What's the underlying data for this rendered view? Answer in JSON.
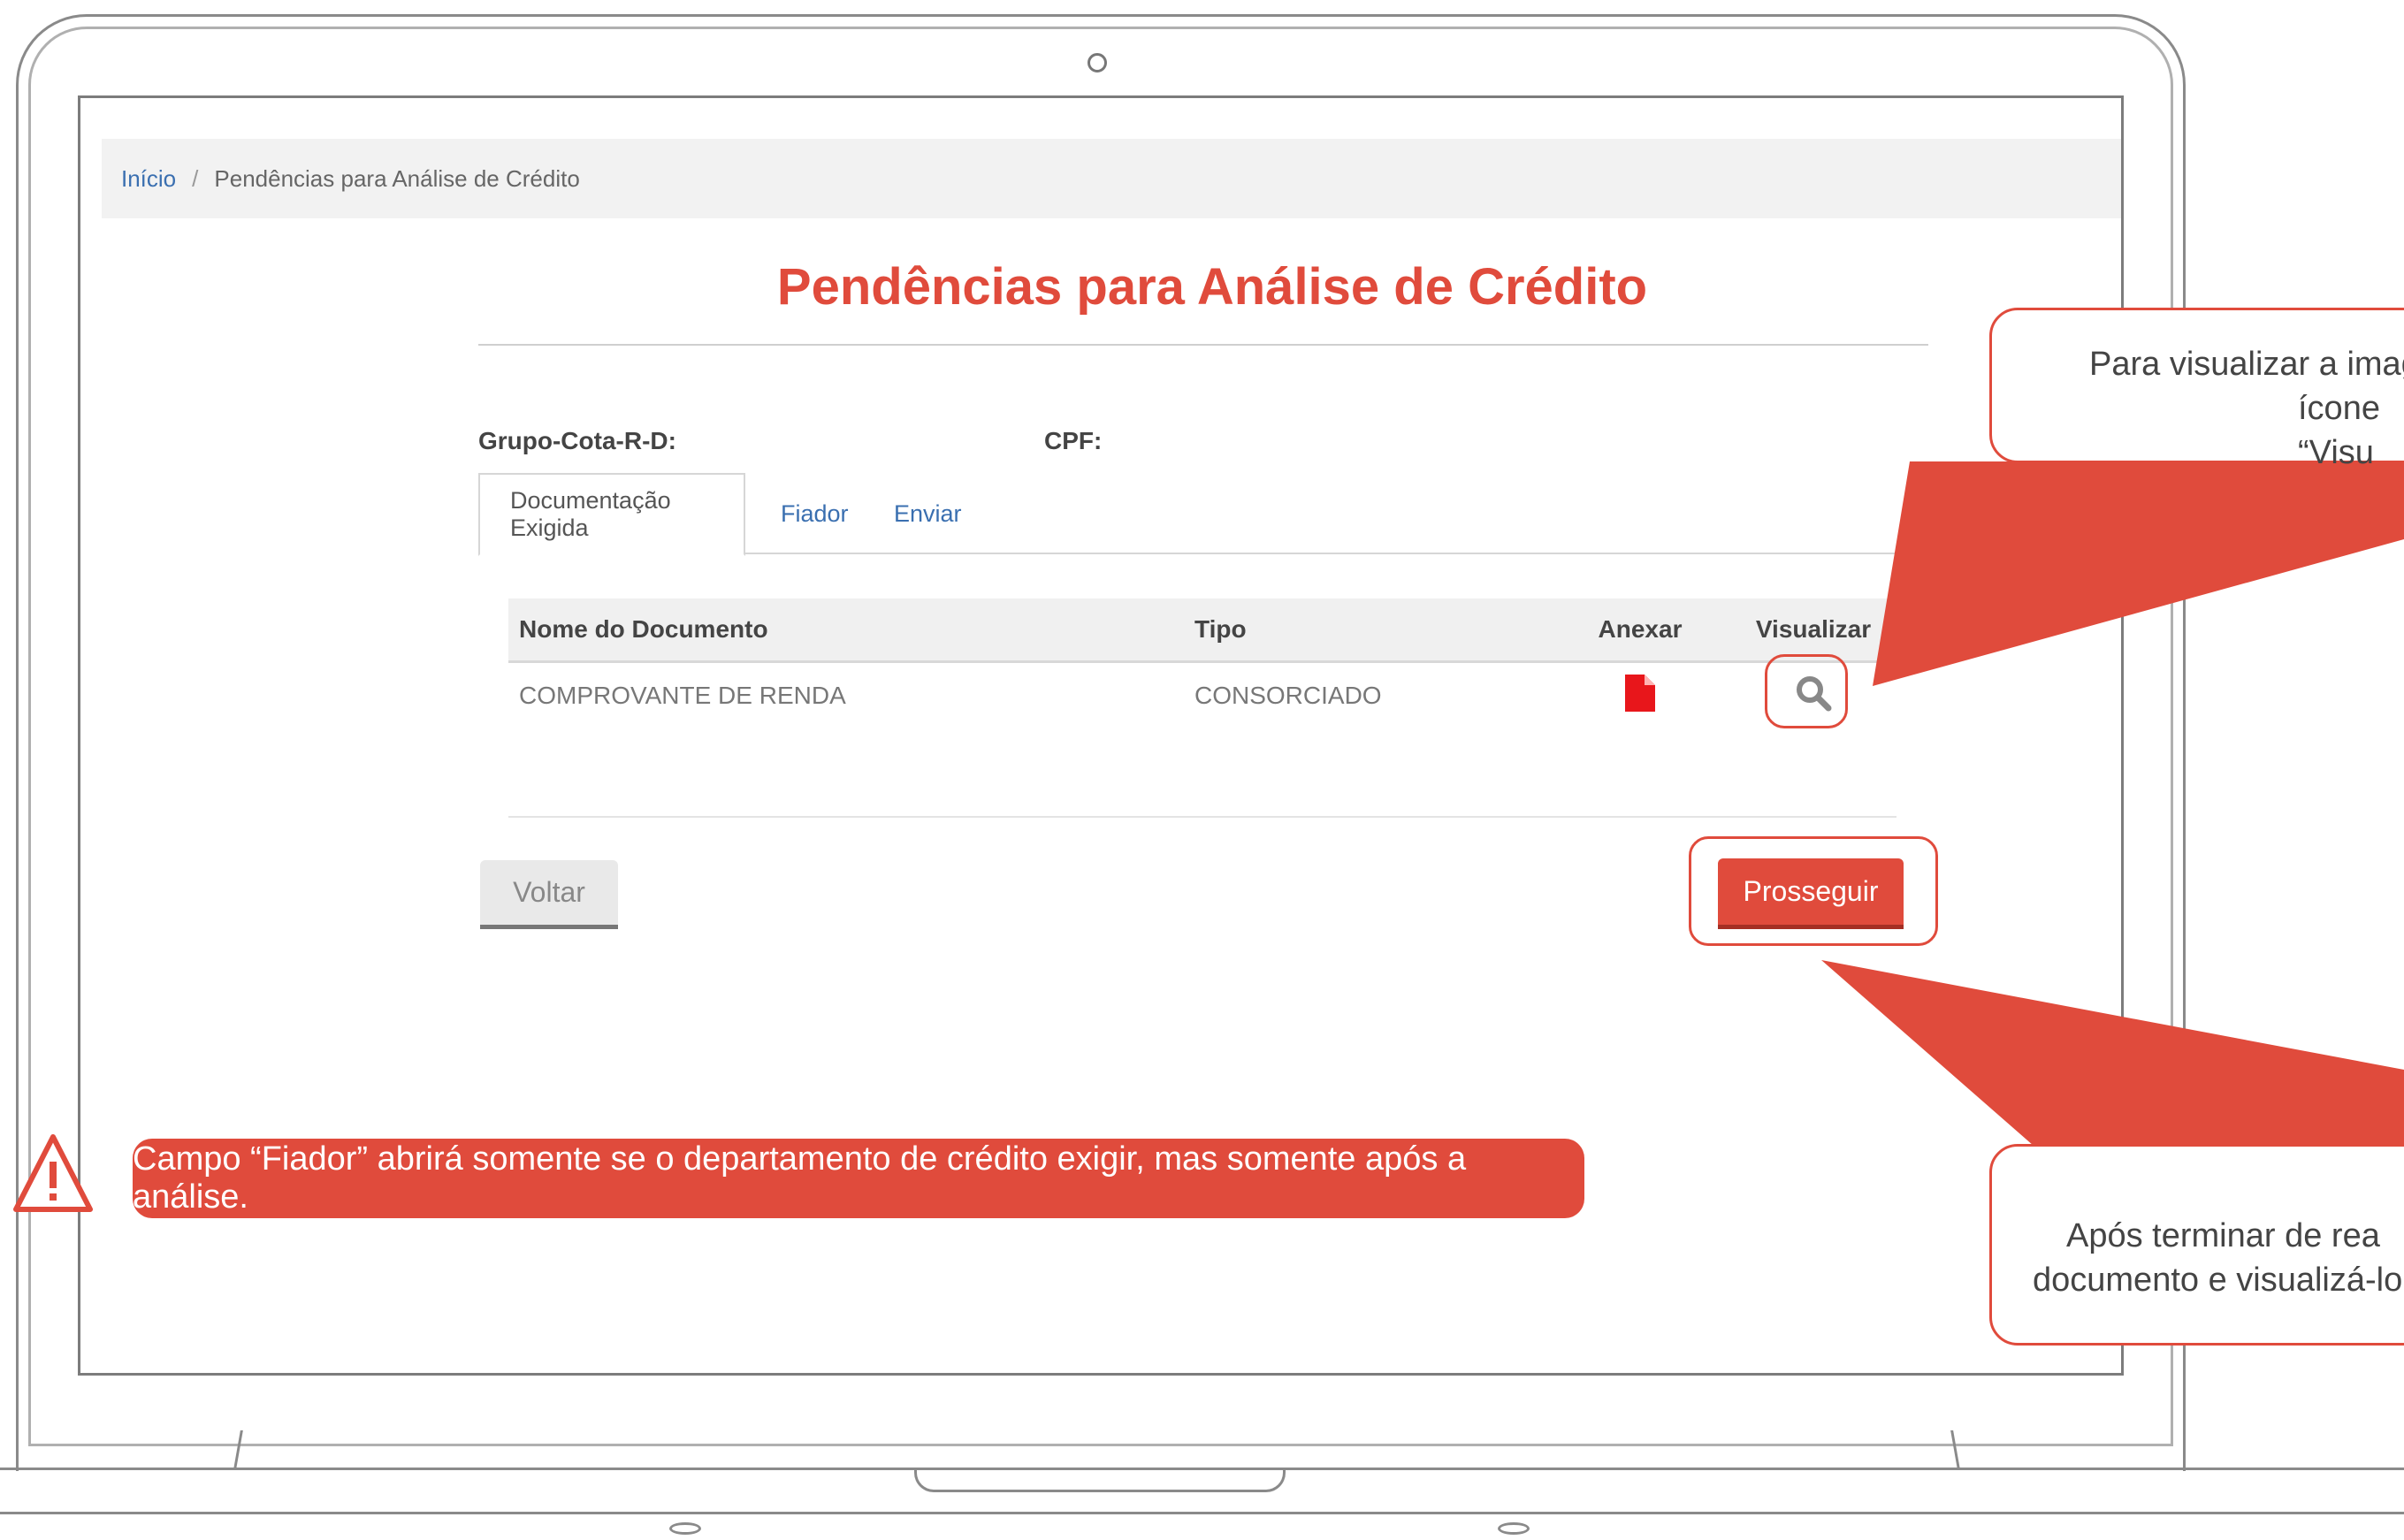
{
  "breadcrumb": {
    "home": "Início",
    "separator": "/",
    "current": "Pendências para Análise de Crédito"
  },
  "page": {
    "title": "Pendências para Análise de Crédito"
  },
  "fields": {
    "group_label": "Grupo-Cota-R-D:",
    "cpf_label": "CPF:"
  },
  "tabs": [
    {
      "label": "Documentação Exigida",
      "active": true
    },
    {
      "label": "Fiador",
      "active": false
    },
    {
      "label": "Enviar",
      "active": false
    }
  ],
  "table": {
    "headers": [
      "Nome do Documento",
      "Tipo",
      "Anexar",
      "Visualizar"
    ],
    "rows": [
      {
        "name": "COMPROVANTE DE RENDA",
        "type": "CONSORCIADO",
        "attach_icon": "pdf-file-icon",
        "view_icon": "search-icon"
      }
    ]
  },
  "buttons": {
    "back": "Voltar",
    "proceed": "Prosseguir"
  },
  "annotations": {
    "top_callout": [
      "Para visualizar a image",
      "ícone “Visu"
    ],
    "bottom_callout": [
      "Após terminar de rea",
      "documento e visualizá-lo,"
    ],
    "note": "Campo “Fiador” abrirá somente se o departamento de crédito exigir, mas somente após a análise."
  },
  "colors": {
    "accent": "#e04b3c",
    "link": "#3a6fb0",
    "pdf_icon": "#e8161b"
  }
}
